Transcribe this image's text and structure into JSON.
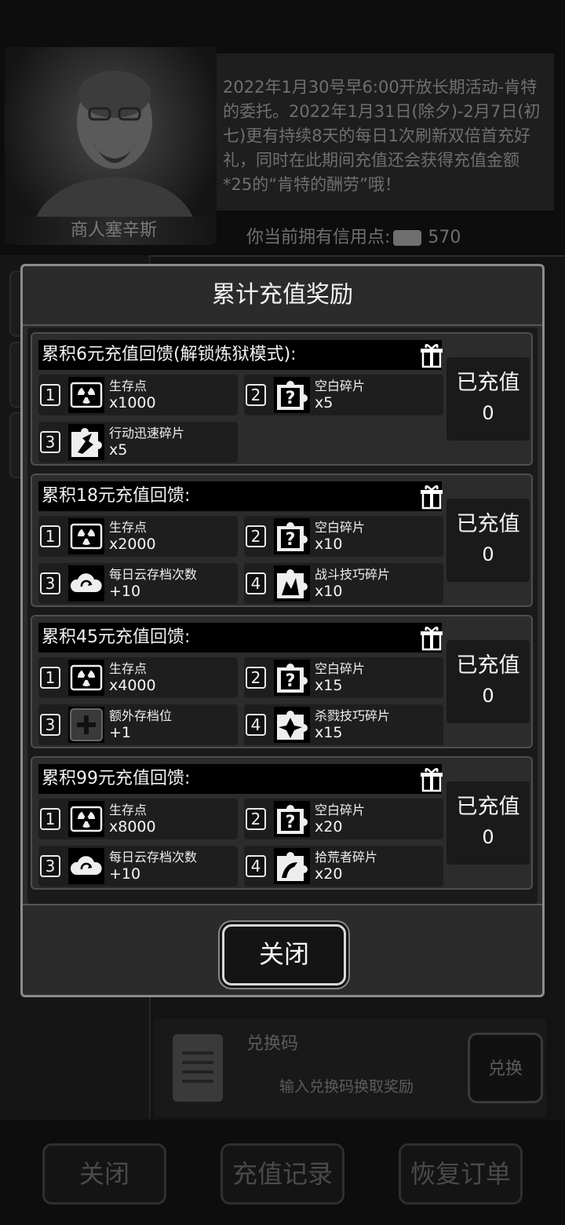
{
  "background": {
    "merchant_name": "商人塞辛斯",
    "announcement": "2022年1月30号早6:00开放长期活动-肯特的委托。2022年1月31日(除夕)-2月7日(初七)更有持续8天的每日1次刷新双倍首充好礼，同时在此期间充值还会获得充值金额*25的“肯特的酬劳”哦！",
    "credit_label": "你当前拥有信用点:",
    "credit_value": "570",
    "redeem": {
      "title": "兑换码",
      "placeholder": "输入兑换码换取奖励",
      "button": "兑换"
    },
    "bottom_buttons": {
      "close": "关闭",
      "history": "充值记录",
      "restore": "恢复订单"
    }
  },
  "modal": {
    "title": "累计充值奖励",
    "close_button": "关闭",
    "paid_label": "已充值",
    "tiers": [
      {
        "title": "累积6元充值回馈(解锁炼狱模式):",
        "paid": "0",
        "rewards": [
          {
            "index": "1",
            "name": "生存点",
            "qty": "x1000",
            "icon": "radiation-icon"
          },
          {
            "index": "2",
            "name": "空白碎片",
            "qty": "x5",
            "icon": "blank-shard-icon"
          },
          {
            "index": "3",
            "name": "行动迅速碎片",
            "qty": "x5",
            "icon": "swift-shard-icon"
          }
        ]
      },
      {
        "title": "累积18元充值回馈:",
        "paid": "0",
        "rewards": [
          {
            "index": "1",
            "name": "生存点",
            "qty": "x2000",
            "icon": "radiation-icon"
          },
          {
            "index": "2",
            "name": "空白碎片",
            "qty": "x10",
            "icon": "blank-shard-icon"
          },
          {
            "index": "3",
            "name": "每日云存档次数",
            "qty": "+10",
            "icon": "cloud-icon"
          },
          {
            "index": "4",
            "name": "战斗技巧碎片",
            "qty": "x10",
            "icon": "combat-shard-icon"
          }
        ]
      },
      {
        "title": "累积45元充值回馈:",
        "paid": "0",
        "rewards": [
          {
            "index": "1",
            "name": "生存点",
            "qty": "x4000",
            "icon": "radiation-icon"
          },
          {
            "index": "2",
            "name": "空白碎片",
            "qty": "x15",
            "icon": "blank-shard-icon"
          },
          {
            "index": "3",
            "name": "额外存档位",
            "qty": "+1",
            "icon": "plus-slot-icon"
          },
          {
            "index": "4",
            "name": "杀戮技巧碎片",
            "qty": "x15",
            "icon": "slaughter-shard-icon"
          }
        ]
      },
      {
        "title": "累积99元充值回馈:",
        "paid": "0",
        "rewards": [
          {
            "index": "1",
            "name": "生存点",
            "qty": "x8000",
            "icon": "radiation-icon"
          },
          {
            "index": "2",
            "name": "空白碎片",
            "qty": "x20",
            "icon": "blank-shard-icon"
          },
          {
            "index": "3",
            "name": "每日云存档次数",
            "qty": "+10",
            "icon": "cloud-icon"
          },
          {
            "index": "4",
            "name": "拾荒者碎片",
            "qty": "x20",
            "icon": "scavenger-shard-icon"
          }
        ]
      }
    ]
  }
}
